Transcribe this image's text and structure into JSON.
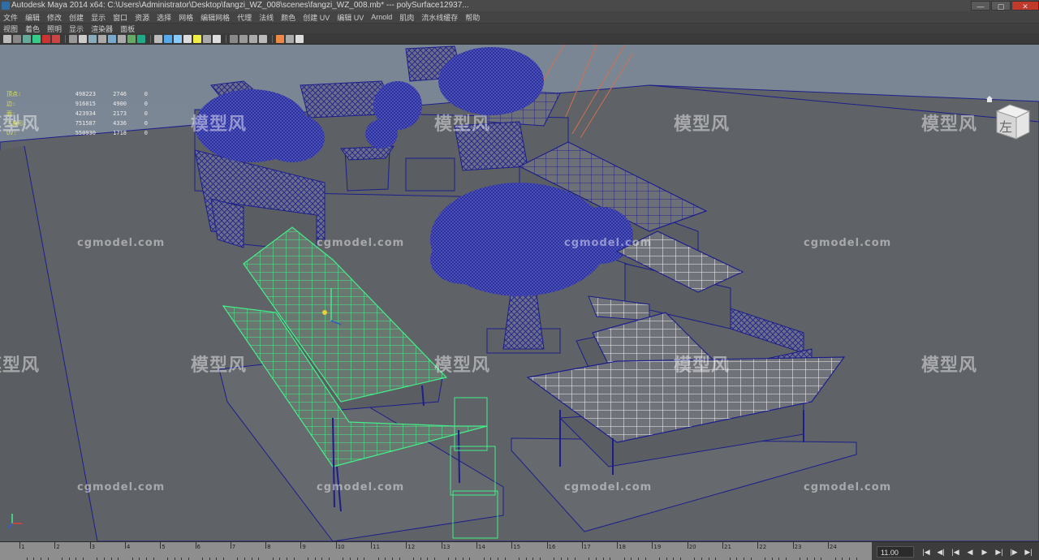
{
  "window": {
    "title": "Autodesk Maya 2014 x64: C:\\Users\\Administrator\\Desktop\\fangzi_WZ_008\\scenes\\fangzi_WZ_008.mb* --- polySurface12937...",
    "min_label": "—",
    "max_label": "▢",
    "close_label": "✕"
  },
  "menu": [
    "文件",
    "编辑",
    "修改",
    "创建",
    "显示",
    "窗口",
    "资源",
    "选择",
    "网格",
    "编辑网格",
    "代理",
    "法线",
    "颜色",
    "创建 UV",
    "编辑 UV",
    "Arnold",
    "肌肉",
    "流水线缓存",
    "帮助"
  ],
  "panel_menu": [
    "视图",
    "着色",
    "照明",
    "显示",
    "渲染器",
    "面板"
  ],
  "hud": {
    "rows": [
      {
        "label": "顶点:",
        "v1": "498223",
        "v2": "2746",
        "v3": "0"
      },
      {
        "label": "边:",
        "v1": "916015",
        "v2": "4900",
        "v3": "0"
      },
      {
        "label": "面:",
        "v1": "423934",
        "v2": "2173",
        "v3": "0"
      },
      {
        "label": "三角形:",
        "v1": "751587",
        "v2": "4336",
        "v3": "0"
      },
      {
        "label": "UV:",
        "v1": "550930",
        "v2": "1718",
        "v3": "0"
      }
    ]
  },
  "viewcube": {
    "face_label": "左"
  },
  "watermarks": {
    "brand": "模型风",
    "site": "cgmodel.com"
  },
  "timeline": {
    "ticks": [
      "1",
      "2",
      "3",
      "4",
      "5",
      "6",
      "7",
      "8",
      "9",
      "10",
      "11",
      "12",
      "13",
      "14",
      "15",
      "16",
      "17",
      "18",
      "19",
      "20",
      "21",
      "22",
      "23",
      "24"
    ],
    "current_frame": "11.00"
  },
  "playback": {
    "go_start": "|◀",
    "step_back_key": "◀|",
    "step_back": "|◀",
    "play_back": "◀",
    "play_forward": "▶",
    "step_forward": "▶|",
    "step_forward_key": "|▶",
    "go_end": "▶|"
  },
  "colors": {
    "wireframe": "#1c1f8a",
    "selected": "#43f08a",
    "ground": "#5c5f63",
    "hud_label": "#d8e05a"
  }
}
